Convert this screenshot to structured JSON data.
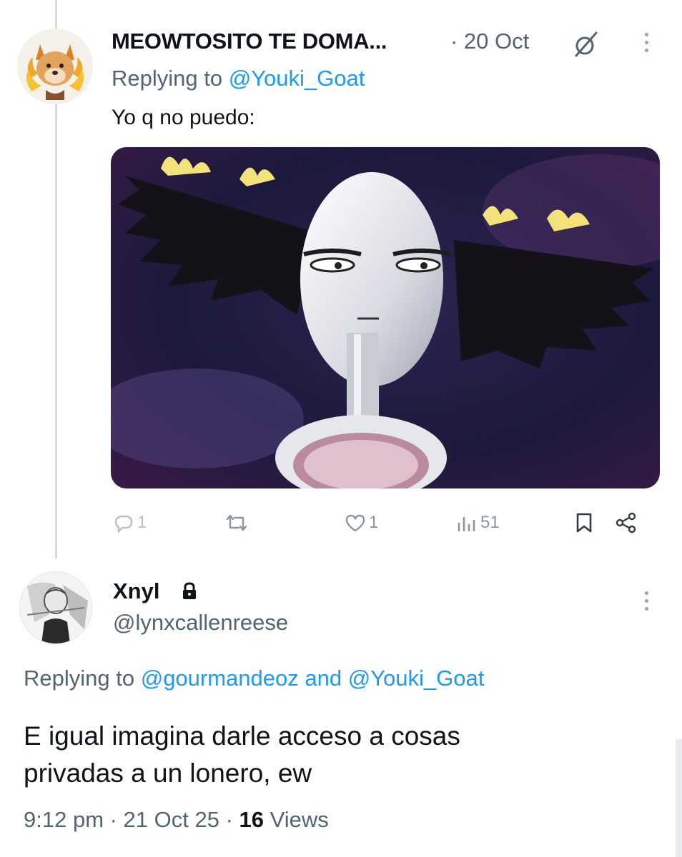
{
  "tweet1": {
    "display_name": "MEOWTOSITO TE DOMA...",
    "date": "· 20 Oct",
    "replying_prefix": "Replying to",
    "replying_handle": "@Youki_Goat",
    "text": "Yo q no puedo:",
    "actions": {
      "replies": "1",
      "likes": "1",
      "views": "51"
    }
  },
  "tweet2": {
    "display_name": "Xnyl",
    "handle": "@lynxcallenreese",
    "replying_prefix": "Replying to",
    "replying_handle_1": "@gourmandeoz",
    "replying_and": "and",
    "replying_handle_2": "@Youki_Goat",
    "text_line_1": "E igual imagina darle acceso a cosas",
    "text_line_2": "privadas a un lonero, ew",
    "meta_time": "9:12 pm · 21 Oct 25 ·",
    "views_count": "16",
    "views_label": "Views"
  },
  "icons": {
    "more": "more-vertical-icon",
    "grok": "grok-icon",
    "reply": "reply-icon",
    "retweet": "retweet-icon",
    "like": "heart-icon",
    "views": "views-chart-icon",
    "bookmark": "bookmark-icon",
    "share": "share-icon",
    "lock": "lock-icon"
  },
  "colors": {
    "link": "#1d9bf0",
    "secondary_text": "#536471",
    "primary_text": "#0f1419",
    "icon_gray": "#8a96a0"
  }
}
